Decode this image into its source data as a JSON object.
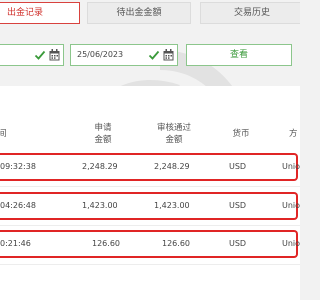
{
  "tabs": [
    {
      "label": "出金记录"
    },
    {
      "label": "待出金金額"
    },
    {
      "label": "交易历史"
    }
  ],
  "filter": {
    "start_date": "",
    "end_date": "25/06/2023",
    "search_label": "查看"
  },
  "table": {
    "columns": [
      {
        "lines": [
          "间"
        ]
      },
      {
        "lines": [
          "申请",
          "金额"
        ]
      },
      {
        "lines": [
          "审核通过",
          "金额"
        ]
      },
      {
        "lines": [
          "货币"
        ]
      },
      {
        "lines": [
          "方"
        ]
      }
    ],
    "rows": [
      {
        "time": "09:32:38",
        "requested": "2,248.29",
        "approved": "2,248.29",
        "currency": "USD",
        "method": "Unio"
      },
      {
        "time": "04:26:48",
        "requested": "1,423.00",
        "approved": "1,423.00",
        "currency": "USD",
        "method": "Unio"
      },
      {
        "time": "0:21:46",
        "requested": "126.60",
        "approved": "126.60",
        "currency": "USD",
        "method": "Unio"
      }
    ]
  },
  "colors": {
    "accent_red": "#d0302b",
    "highlight_red": "#e02525",
    "accent_green": "#3a9a3a"
  }
}
